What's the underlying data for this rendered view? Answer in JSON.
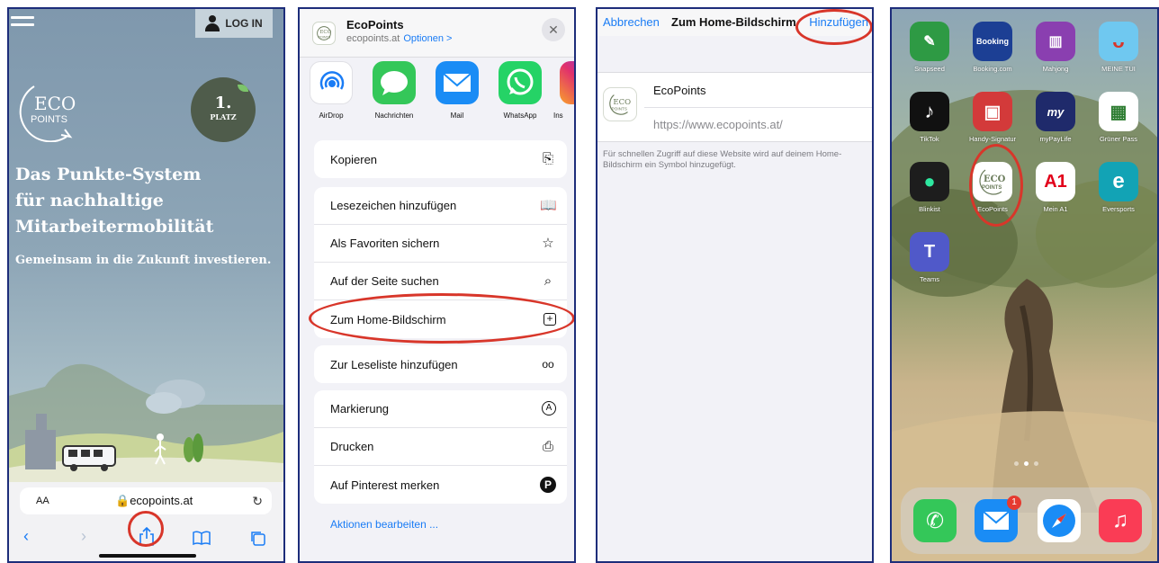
{
  "panel1": {
    "login_label": "LOG IN",
    "logo_top": "ECO",
    "logo_bottom": "POINTS",
    "badge_number": "1.",
    "badge_word": "PLATZ",
    "headline_lines": [
      "Das Punkte-System",
      "für nachhaltige",
      "Mitarbeitermobilität"
    ],
    "subline": "Gemeinsam in die Zukunft investieren.",
    "font_size_label": "AA",
    "url": "ecopoints.at"
  },
  "panel2": {
    "site_name": "EcoPoints",
    "site_url": "ecopoints.at",
    "options_label": "Optionen >",
    "apps": [
      {
        "label": "AirDrop",
        "icon": "airdrop-icon"
      },
      {
        "label": "Nachrichten",
        "icon": "messages-icon"
      },
      {
        "label": "Mail",
        "icon": "mail-icon"
      },
      {
        "label": "WhatsApp",
        "icon": "whatsapp-icon"
      },
      {
        "label": "Ins",
        "icon": "instagram-icon"
      }
    ],
    "group1": [
      {
        "label": "Kopieren",
        "icon": "copy-icon"
      }
    ],
    "group2": [
      {
        "label": "Lesezeichen hinzufügen",
        "icon": "book-icon"
      },
      {
        "label": "Als Favoriten sichern",
        "icon": "star-icon"
      },
      {
        "label": "Auf der Seite suchen",
        "icon": "search-icon"
      },
      {
        "label": "Zum Home-Bildschirm",
        "icon": "add-square-icon"
      }
    ],
    "group3": [
      {
        "label": "Zur Leseliste hinzufügen",
        "icon": "glasses-icon"
      }
    ],
    "group4": [
      {
        "label": "Markierung",
        "icon": "markup-icon"
      },
      {
        "label": "Drucken",
        "icon": "print-icon"
      },
      {
        "label": "Auf Pinterest merken",
        "icon": "pinterest-icon"
      }
    ],
    "edit_actions": "Aktionen bearbeiten ..."
  },
  "panel3": {
    "cancel": "Abbrechen",
    "title": "Zum Home-Bildschirm",
    "add": "Hinzufügen",
    "app_name": "EcoPoints",
    "app_url": "https://www.ecopoints.at/",
    "note": "Für schnellen Zugriff auf diese Website wird auf deinem Home-Bildschirm ein Symbol hinzugefügt."
  },
  "panel4": {
    "apps": [
      {
        "label": "Snapseed",
        "color": "#2e9a44",
        "glyph": "✎"
      },
      {
        "label": "Booking.com",
        "color": "#1c3f94",
        "glyph": "Booking"
      },
      {
        "label": "Mahjong",
        "color": "#8a3fb0",
        "glyph": "🀄"
      },
      {
        "label": "MEINE TUI",
        "color": "#6fc8f0",
        "glyph": "ᴗ"
      },
      {
        "label": "TikTok",
        "color": "#111111",
        "glyph": "♪"
      },
      {
        "label": "Handy-Signatur",
        "color": "#d33a3a",
        "glyph": "▣"
      },
      {
        "label": "myPayLife",
        "color": "#1f2a6b",
        "glyph": "my"
      },
      {
        "label": "Grüner Pass",
        "color": "#ffffff",
        "glyph": "▦"
      },
      {
        "label": "Blinkist",
        "color": "#1d1d1d",
        "glyph": "●"
      },
      {
        "label": "EcoPoints",
        "color": "#ffffff",
        "glyph": "ECO"
      },
      {
        "label": "Mein A1",
        "color": "#ffffff",
        "glyph": "A1"
      },
      {
        "label": "Eversports",
        "color": "#12a3b5",
        "glyph": "e"
      },
      {
        "label": "Teams",
        "color": "#5059c9",
        "glyph": "T"
      }
    ],
    "mail_badge": "1",
    "dock": [
      {
        "label": "phone",
        "color": "#34c759"
      },
      {
        "label": "mail",
        "color": "#1a8cf5"
      },
      {
        "label": "safari",
        "color": "#ffffff"
      },
      {
        "label": "music",
        "color": "#fa3c55"
      }
    ]
  },
  "colors": {
    "highlight": "#d8362a",
    "ios_blue": "#1a7cf5",
    "frame": "#1d2d7a"
  }
}
